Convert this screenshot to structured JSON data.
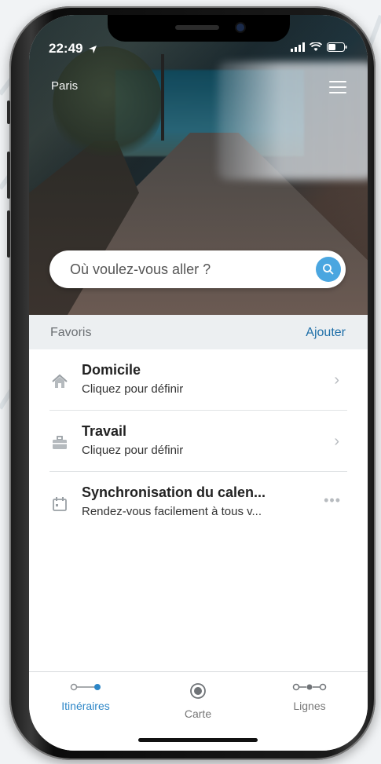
{
  "status": {
    "time": "22:49"
  },
  "header": {
    "city": "Paris"
  },
  "search": {
    "placeholder": "Où voulez-vous aller ?"
  },
  "favorites": {
    "title": "Favoris",
    "add_label": "Ajouter",
    "items": [
      {
        "icon": "home-icon",
        "title": "Domicile",
        "subtitle": "Cliquez pour définir",
        "action": "chevron-right-icon"
      },
      {
        "icon": "briefcase-icon",
        "title": "Travail",
        "subtitle": "Cliquez pour définir",
        "action": "chevron-right-icon"
      },
      {
        "icon": "calendar-icon",
        "title": "Synchronisation du calen...",
        "subtitle": "Rendez-vous facilement à tous v...",
        "action": "more-icon"
      }
    ]
  },
  "tabs": [
    {
      "label": "Itinéraires",
      "icon": "route-icon",
      "active": true
    },
    {
      "label": "Carte",
      "icon": "map-target-icon",
      "active": false
    },
    {
      "label": "Lignes",
      "icon": "lines-icon",
      "active": false
    }
  ],
  "colors": {
    "accent": "#2c86c7",
    "search_button": "#4aa6e0",
    "favorites_bar": "#eceff1"
  }
}
